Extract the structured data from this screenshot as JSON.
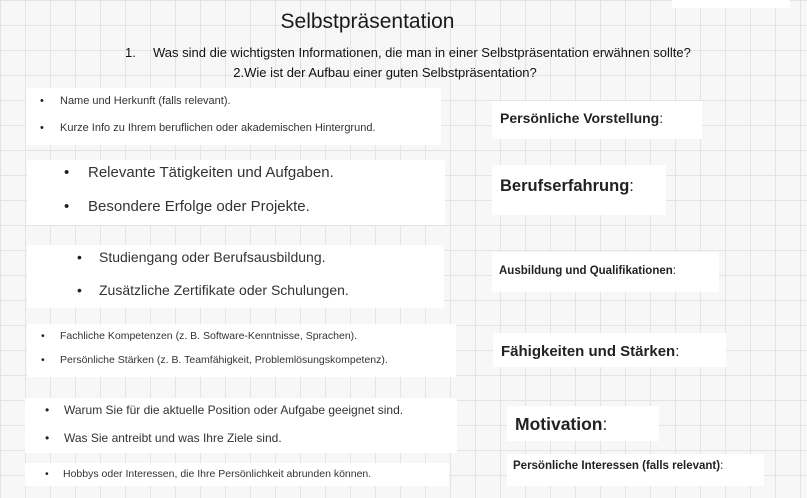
{
  "title": "Selbstpräsentation",
  "questions": {
    "q1_number": "1.",
    "q1_text": "Was sind die wichtigsten Informationen, die man in einer Selbstpräsentation erwähnen sollte?",
    "q2_text": "2.Wie ist der Aufbau einer guten Selbstpräsentation?"
  },
  "sections": [
    {
      "label": "Persönliche Vorstellung",
      "colon": ":",
      "items": [
        "Name und Herkunft (falls relevant).",
        "Kurze Info zu Ihrem beruflichen oder akademischen Hintergrund."
      ]
    },
    {
      "label": "Berufserfahrung",
      "colon": ":",
      "items": [
        "Relevante Tätigkeiten und Aufgaben.",
        "Besondere Erfolge oder Projekte."
      ]
    },
    {
      "label": "Ausbildung und Qualifikationen",
      "colon": ":",
      "items": [
        "Studiengang oder Berufsausbildung.",
        "Zusätzliche Zertifikate oder Schulungen."
      ]
    },
    {
      "label": "Fähigkeiten und Stärken",
      "colon": ":",
      "items": [
        "Fachliche Kompetenzen (z. B. Software-Kenntnisse, Sprachen).",
        "Persönliche Stärken (z. B. Teamfähigkeit, Problemlösungskompetenz)."
      ]
    },
    {
      "label": "Motivation",
      "colon": ":",
      "items": [
        "Warum Sie für die aktuelle Position oder Aufgabe geeignet sind.",
        "Was Sie antreibt und was Ihre Ziele sind."
      ]
    },
    {
      "label": "Persönliche Interessen (falls relevant)",
      "colon": ":",
      "items": [
        "Hobbys oder Interessen, die Ihre Persönlichkeit abrunden können."
      ]
    }
  ]
}
